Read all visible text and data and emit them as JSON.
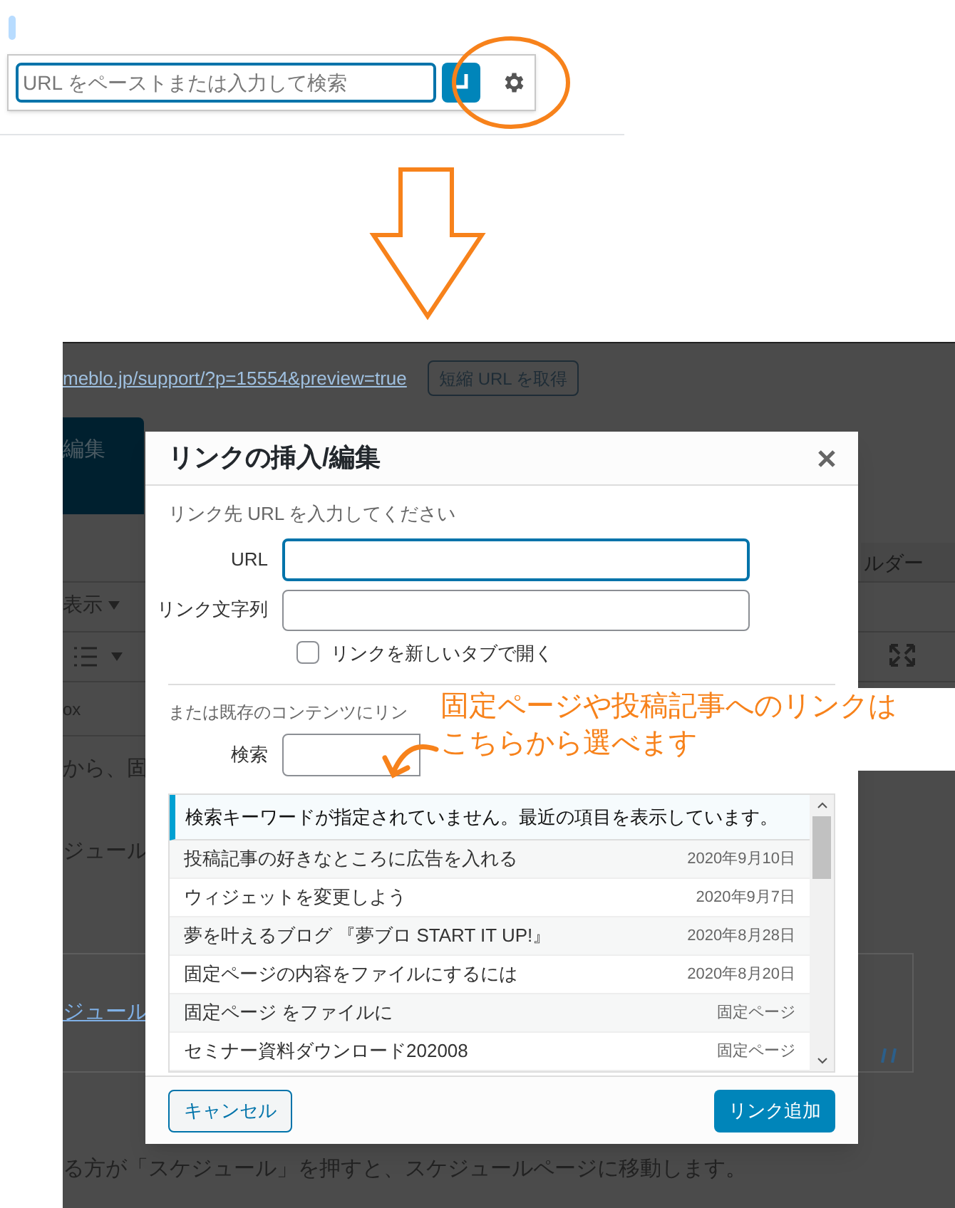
{
  "link_toolbar": {
    "placeholder": "URL をペーストまたは入力して検索"
  },
  "editor_background": {
    "permalink": "meblo.jp/support/?p=15554&preview=true",
    "shortlink_button": "短縮 URL を取得",
    "tab": "編集",
    "builder_tab": "ルダー",
    "view_menu": "表示",
    "quicktags_fragment": "ox",
    "text_fragments": [
      "から、固",
      "ジュール"
    ],
    "link_fragment": "ジュール",
    "bottom_text": "る方が「スケジュール」を押すと、スケジュールページに移動します。"
  },
  "dialog": {
    "title": "リンクの挿入/編集",
    "instruction": "リンク先 URL を入力してください",
    "url_label": "URL",
    "text_label": "リンク文字列",
    "new_tab": {
      "label": "リンクを新しいタブで開く",
      "checked": false
    },
    "existing_label": "または既存のコンテンツにリン",
    "search_label": "検索",
    "notice": "検索キーワードが指定されていません。最近の項目を表示しています。",
    "results": [
      {
        "title": "投稿記事の好きなところに広告を入れる",
        "info": "2020年9月10日"
      },
      {
        "title": "ウィジェットを変更しよう",
        "info": "2020年9月7日"
      },
      {
        "title": "夢を叶えるブログ 『夢ブロ START IT UP!』",
        "info": "2020年8月28日"
      },
      {
        "title": "固定ページの内容をファイルにするには",
        "info": "2020年8月20日"
      },
      {
        "title": "固定ページ をファイルに",
        "info": "固定ページ"
      },
      {
        "title": "セミナー資料ダウンロード202008",
        "info": "固定ページ"
      }
    ],
    "cancel_button": "キャンセル",
    "submit_button": "リンク追加"
  },
  "annotation": {
    "lines": [
      "固定ページや投稿記事へのリンクは",
      "こちらから選べます"
    ]
  }
}
